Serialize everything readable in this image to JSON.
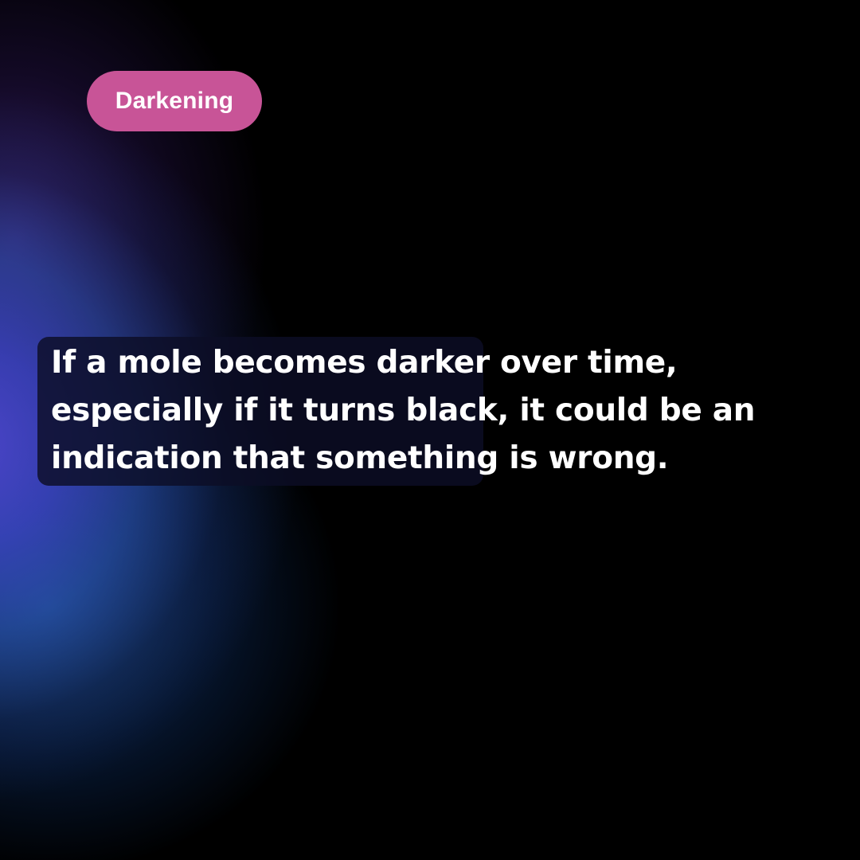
{
  "tag": {
    "label": "Darkening",
    "color": "#c85497"
  },
  "body": {
    "lines": [
      "If a mole becomes darker over time,",
      "especially if it turns black, it could be an",
      "indication that something is wrong."
    ]
  },
  "colors": {
    "background": "#000000",
    "glow_blue": "#4a5bd8",
    "glow_purple": "#5a32aa",
    "text": "#ffffff"
  }
}
